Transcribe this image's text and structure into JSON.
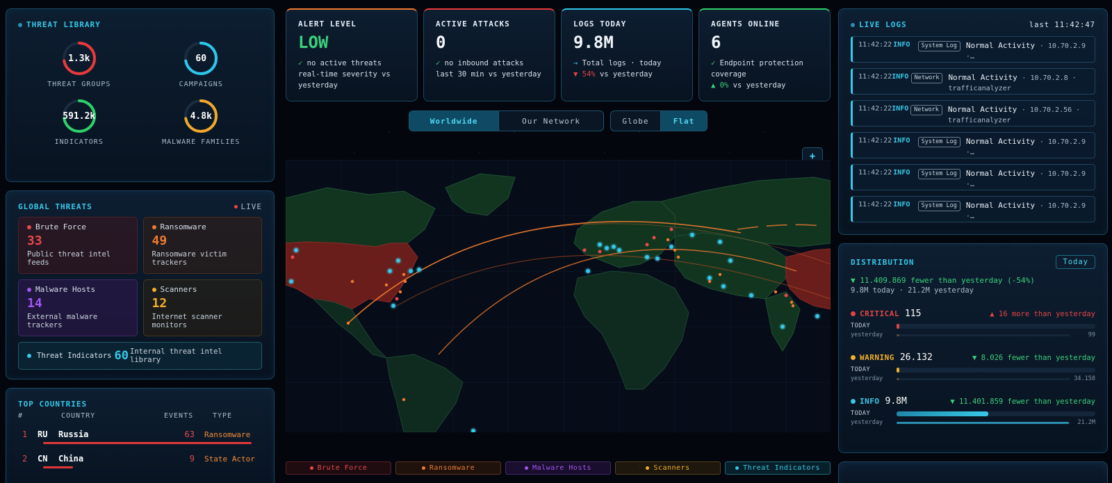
{
  "threat_library": {
    "title": "THREAT LIBRARY",
    "items": [
      {
        "value": "1.3k",
        "label": "THREAT GROUPS",
        "color": "#e83a3a"
      },
      {
        "value": "60",
        "label": "CAMPAIGNS",
        "color": "#2ec8ec"
      },
      {
        "value": "591.2k",
        "label": "INDICATORS",
        "color": "#2ed06a"
      },
      {
        "value": "4.8k",
        "label": "MALWARE FAMILIES",
        "color": "#f2a92a"
      }
    ]
  },
  "global_threats": {
    "title": "GLOBAL THREATS",
    "live": "LIVE",
    "cards": [
      {
        "name": "Brute Force",
        "count": "33",
        "desc": "Public threat intel feeds",
        "color": "#e84a4a"
      },
      {
        "name": "Ransomware",
        "count": "49",
        "desc": "Ransomware victim trackers",
        "color": "#f07a30"
      },
      {
        "name": "Malware Hosts",
        "count": "14",
        "desc": "External malware trackers",
        "color": "#a256f0"
      },
      {
        "name": "Scanners",
        "count": "12",
        "desc": "Internet scanner monitors",
        "color": "#f2b02a"
      }
    ],
    "indicators": {
      "name": "Threat Indicators",
      "count": "60",
      "desc": "Internal threat intel library",
      "color": "#38c8e8"
    }
  },
  "top_countries": {
    "title": "TOP COUNTRIES",
    "columns": [
      "#",
      "COUNTRY",
      "EVENTS",
      "TYPE"
    ],
    "rows": [
      {
        "rank": "1",
        "code": "RU",
        "name": "Russia",
        "events": "63",
        "type": "Ransomware",
        "share": 1.0
      },
      {
        "rank": "2",
        "code": "CN",
        "name": "China",
        "events": "9",
        "type": "State Actor",
        "share": 0.143
      }
    ]
  },
  "stats": [
    {
      "title": "ALERT LEVEL",
      "value": "LOW",
      "value_color": "#3cd07a",
      "accent": "#f07a30",
      "line1_mark": "✓",
      "line1": "no active threats",
      "line2": "real-time severity vs yesterday"
    },
    {
      "title": "ACTIVE ATTACKS",
      "value": "0",
      "value_color": "#f2f6fa",
      "accent": "#e83a3a",
      "line1_mark": "✓",
      "line1": "no inbound attacks",
      "line2": "last 30 min vs yesterday"
    },
    {
      "title": "LOGS TODAY",
      "value": "9.8M",
      "value_color": "#f2f6fa",
      "accent": "#2ec8ec",
      "line1_mark": "→",
      "line1": "Total logs · today",
      "line2_mark": "▼ 54%",
      "line2": "vs yesterday"
    },
    {
      "title": "AGENTS ONLINE",
      "value": "6",
      "value_color": "#f2f6fa",
      "accent": "#2ed06a",
      "line1_mark": "✓",
      "line1": "Endpoint protection coverage",
      "line2_mark": "▲ 0%",
      "line2": "vs yesterday"
    }
  ],
  "map_controls": {
    "scope": [
      "Worldwide",
      "Our Network"
    ],
    "scope_active": "Worldwide",
    "view": [
      "Globe",
      "Flat"
    ],
    "view_active": "Flat",
    "zoom_in": "+",
    "zoom_out": "−",
    "fit": "⤢"
  },
  "legend": [
    {
      "label": "Brute Force",
      "color": "#e84a4a"
    },
    {
      "label": "Ransomware",
      "color": "#f07a30"
    },
    {
      "label": "Malware Hosts",
      "color": "#a256f0"
    },
    {
      "label": "Scanners",
      "color": "#f2b02a"
    },
    {
      "label": "Threat Indicators",
      "color": "#38c8e8"
    }
  ],
  "live_logs": {
    "title": "LIVE LOGS",
    "last": "last 11:42:47",
    "entries": [
      {
        "time": "11:42:22",
        "level": "INFO",
        "source": "System Log",
        "message": "Normal Activity",
        "detail": "· 10.70.2.9 ·…"
      },
      {
        "time": "11:42:22",
        "level": "INFO",
        "source": "Network",
        "message": "Normal Activity",
        "detail": "· 10.70.2.8 · trafficanalyzer"
      },
      {
        "time": "11:42:22",
        "level": "INFO",
        "source": "Network",
        "message": "Normal Activity",
        "detail": "· 10.70.2.56 · trafficanalyzer"
      },
      {
        "time": "11:42:22",
        "level": "INFO",
        "source": "System Log",
        "message": "Normal Activity",
        "detail": "· 10.70.2.9 ·…"
      },
      {
        "time": "11:42:22",
        "level": "INFO",
        "source": "System Log",
        "message": "Normal Activity",
        "detail": "· 10.70.2.9 ·…"
      },
      {
        "time": "11:42:22",
        "level": "INFO",
        "source": "System Log",
        "message": "Normal Activity",
        "detail": "· 10.70.2.9 ·…"
      }
    ]
  },
  "distribution": {
    "title": "DISTRIBUTION",
    "period": "Today",
    "summary": "▼ 11.409.869 fewer than yesterday (-54%)",
    "subsummary": "9.8M today · 21.2M yesterday",
    "levels": [
      {
        "label": "CRITICAL",
        "count": "115",
        "delta": "▲ 16 more than yesterday",
        "delta_color": "#e24444",
        "color": "#e24444",
        "today_label": "TODAY",
        "yesterday_label": "yesterday",
        "yesterday_value": "99",
        "today_share": 0.015,
        "yesterday_share": 0.013
      },
      {
        "label": "WARNING",
        "count": "26.132",
        "delta": "▼ 8.026 fewer than yesterday",
        "delta_color": "#3cd07a",
        "color": "#f2b02a",
        "today_label": "TODAY",
        "yesterday_label": "yesterday",
        "yesterday_value": "34.158",
        "today_share": 0.015,
        "yesterday_share": 0.015
      },
      {
        "label": "INFO",
        "count": "9.8M",
        "delta": "▼ 11.401.859 fewer than yesterday",
        "delta_color": "#3cd07a",
        "color": "#38c8e8",
        "today_label": "TODAY",
        "yesterday_label": "yesterday",
        "yesterday_value": "21.2M",
        "today_share": 0.46,
        "yesterday_share": 0.99
      }
    ]
  }
}
